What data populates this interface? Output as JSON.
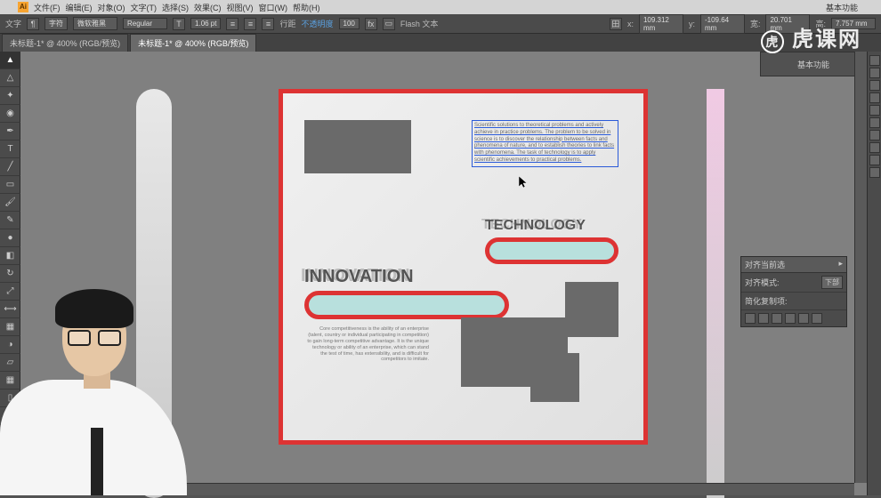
{
  "menubar": {
    "items": [
      "文件(F)",
      "编辑(E)",
      "对象(O)",
      "文字(T)",
      "选择(S)",
      "效果(C)",
      "视图(V)",
      "窗口(W)",
      "帮助(H)"
    ],
    "right": "基本功能"
  },
  "optbar": {
    "label1": "字符",
    "font_label": "微软雅黑",
    "weight": "Regular",
    "size": "1.06 pt",
    "leading_label": "行距",
    "opacity_label": "不透明度",
    "opacity": "100",
    "flash_label": "Flash 文本",
    "x_label": "x:",
    "x_val": "109.312 mm",
    "y_label": "y:",
    "y_val": "-109.64 mm",
    "w_label": "宽:",
    "w_val": "20.701 mm",
    "h_label": "高:",
    "h_val": "7.757 mm"
  },
  "tabs": {
    "t0": "未标题-1* @ 400% (RGB/预览)",
    "t1": "未标题-1* @ 400% (RGB/预览)"
  },
  "watermark": "虎课网",
  "panel_top": {
    "label": "基本功能"
  },
  "floating": {
    "title": "对齐当前选",
    "mode_label": "对齐模式:",
    "mode_val": "下部",
    "dist_label": "简化复制项:"
  },
  "artboard": {
    "tech_shadow": "TECHNOLOGY",
    "tech_main": "TECHNOLOGY",
    "innov_shadow": "INNOVATION",
    "innov_main": "INNOVATION",
    "text_tr": "Scientific solutions to theoretical problems and actively achieve in practice problems. The problem to be solved in science is to discover the relationship between facts and phenomena of nature, and to establish theories to link facts with phenomena. The task of technology is to apply scientific achievements to practical problems.",
    "text_bl": "Core competitiveness is the ability of an enterprise (talent, country or individual participating in competition) to gain long-term competitive advantage. It is the unique technology or ability of an enterprise, which can stand the test of time, has extensibility, and is difficult for competitors to imitate."
  }
}
